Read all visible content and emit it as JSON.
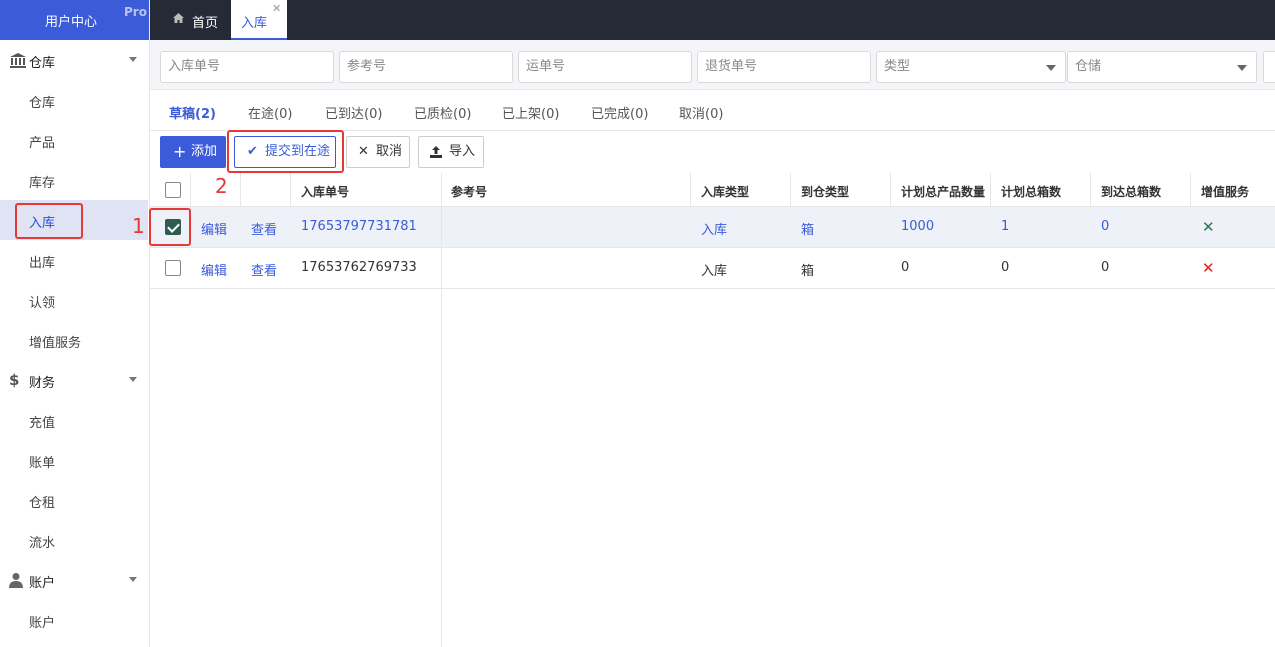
{
  "sidebar": {
    "brand": "用户中心",
    "badge": "Pro",
    "groups": [
      {
        "label": "仓库",
        "icon": "bank-icon"
      },
      {
        "label": "财务",
        "icon": "dollar-icon"
      },
      {
        "label": "账户",
        "icon": "user-icon"
      }
    ],
    "items": [
      "仓库",
      "产品",
      "库存",
      "入库",
      "出库",
      "认领",
      "增值服务",
      "充值",
      "账单",
      "仓租",
      "流水",
      "账户"
    ],
    "active_item": "入库"
  },
  "tabs": {
    "home": "首页",
    "active": "入库"
  },
  "filters": {
    "inbound_no": "入库单号",
    "reference_no": "参考号",
    "waybill_no": "运单号",
    "return_no": "退货单号",
    "type": "类型",
    "warehouse": "仓储"
  },
  "status_tabs": [
    "草稿(2)",
    "在途(0)",
    "已到达(0)",
    "已质检(0)",
    "已上架(0)",
    "已完成(0)",
    "取消(0)"
  ],
  "actions": {
    "add": "添加",
    "submit": "提交到在途",
    "cancel": "取消",
    "import": "导入"
  },
  "table": {
    "columns": [
      "入库单号",
      "参考号",
      "入库类型",
      "到仓类型",
      "计划总产品数量",
      "计划总箱数",
      "到达总箱数",
      "增值服务"
    ],
    "edit_label": "编辑",
    "view_label": "查看",
    "rows": [
      {
        "checked": true,
        "no": "17653797731781",
        "ref": "",
        "type": "入库",
        "arrival": "箱",
        "qty": "1000",
        "boxes": "1",
        "arrived": "0",
        "vas": "✕",
        "vas_color": "#1f7a4d"
      },
      {
        "checked": false,
        "no": "17653762769733",
        "ref": "",
        "type": "入库",
        "arrival": "箱",
        "qty": "0",
        "boxes": "0",
        "arrived": "0",
        "vas": "✕",
        "vas_color": "#e02020"
      }
    ]
  },
  "annotations": [
    "1",
    "2"
  ],
  "colors": {
    "accent": "#3b5bd9",
    "annotation": "#e53935",
    "topbar": "#262a36"
  }
}
